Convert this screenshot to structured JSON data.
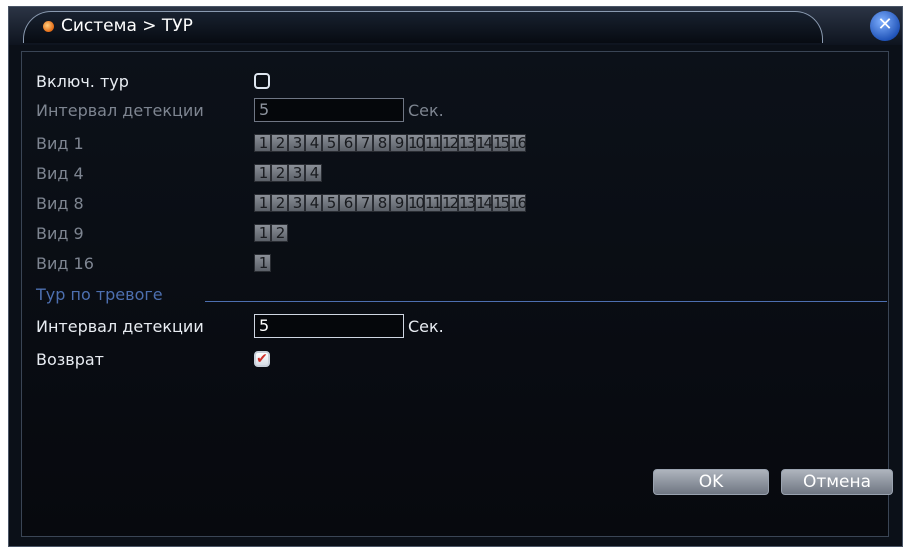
{
  "window": {
    "title": "Система > ТУР",
    "close_symbol": "✕",
    "icon": "orange-dot-icon"
  },
  "tour": {
    "enable_label": "Включ. тур",
    "enable_checked": false,
    "interval_label": "Интервал детекции",
    "interval_value": "5",
    "interval_unit": "Сек.",
    "views": [
      {
        "label": "Вид 1",
        "channels": [
          "1",
          "2",
          "3",
          "4",
          "5",
          "6",
          "7",
          "8",
          "9",
          "10",
          "11",
          "12",
          "13",
          "14",
          "15",
          "16"
        ]
      },
      {
        "label": "Вид 4",
        "channels": [
          "1",
          "2",
          "3",
          "4"
        ]
      },
      {
        "label": "Вид 8",
        "channels": [
          "1",
          "2",
          "3",
          "4",
          "5",
          "6",
          "7",
          "8",
          "9",
          "10",
          "11",
          "12",
          "13",
          "14",
          "15",
          "16"
        ]
      },
      {
        "label": "Вид 9",
        "channels": [
          "1",
          "2"
        ]
      },
      {
        "label": "Вид 16",
        "channels": [
          "1"
        ]
      }
    ]
  },
  "alarm_tour": {
    "section_label": "Тур по тревоге",
    "interval_label": "Интервал детекции",
    "interval_value": "5",
    "interval_unit": "Сек.",
    "return_label": "Возврат",
    "return_checked": true,
    "check_mark": "✔"
  },
  "buttons": {
    "ok": "OK",
    "cancel": "Отмена"
  }
}
